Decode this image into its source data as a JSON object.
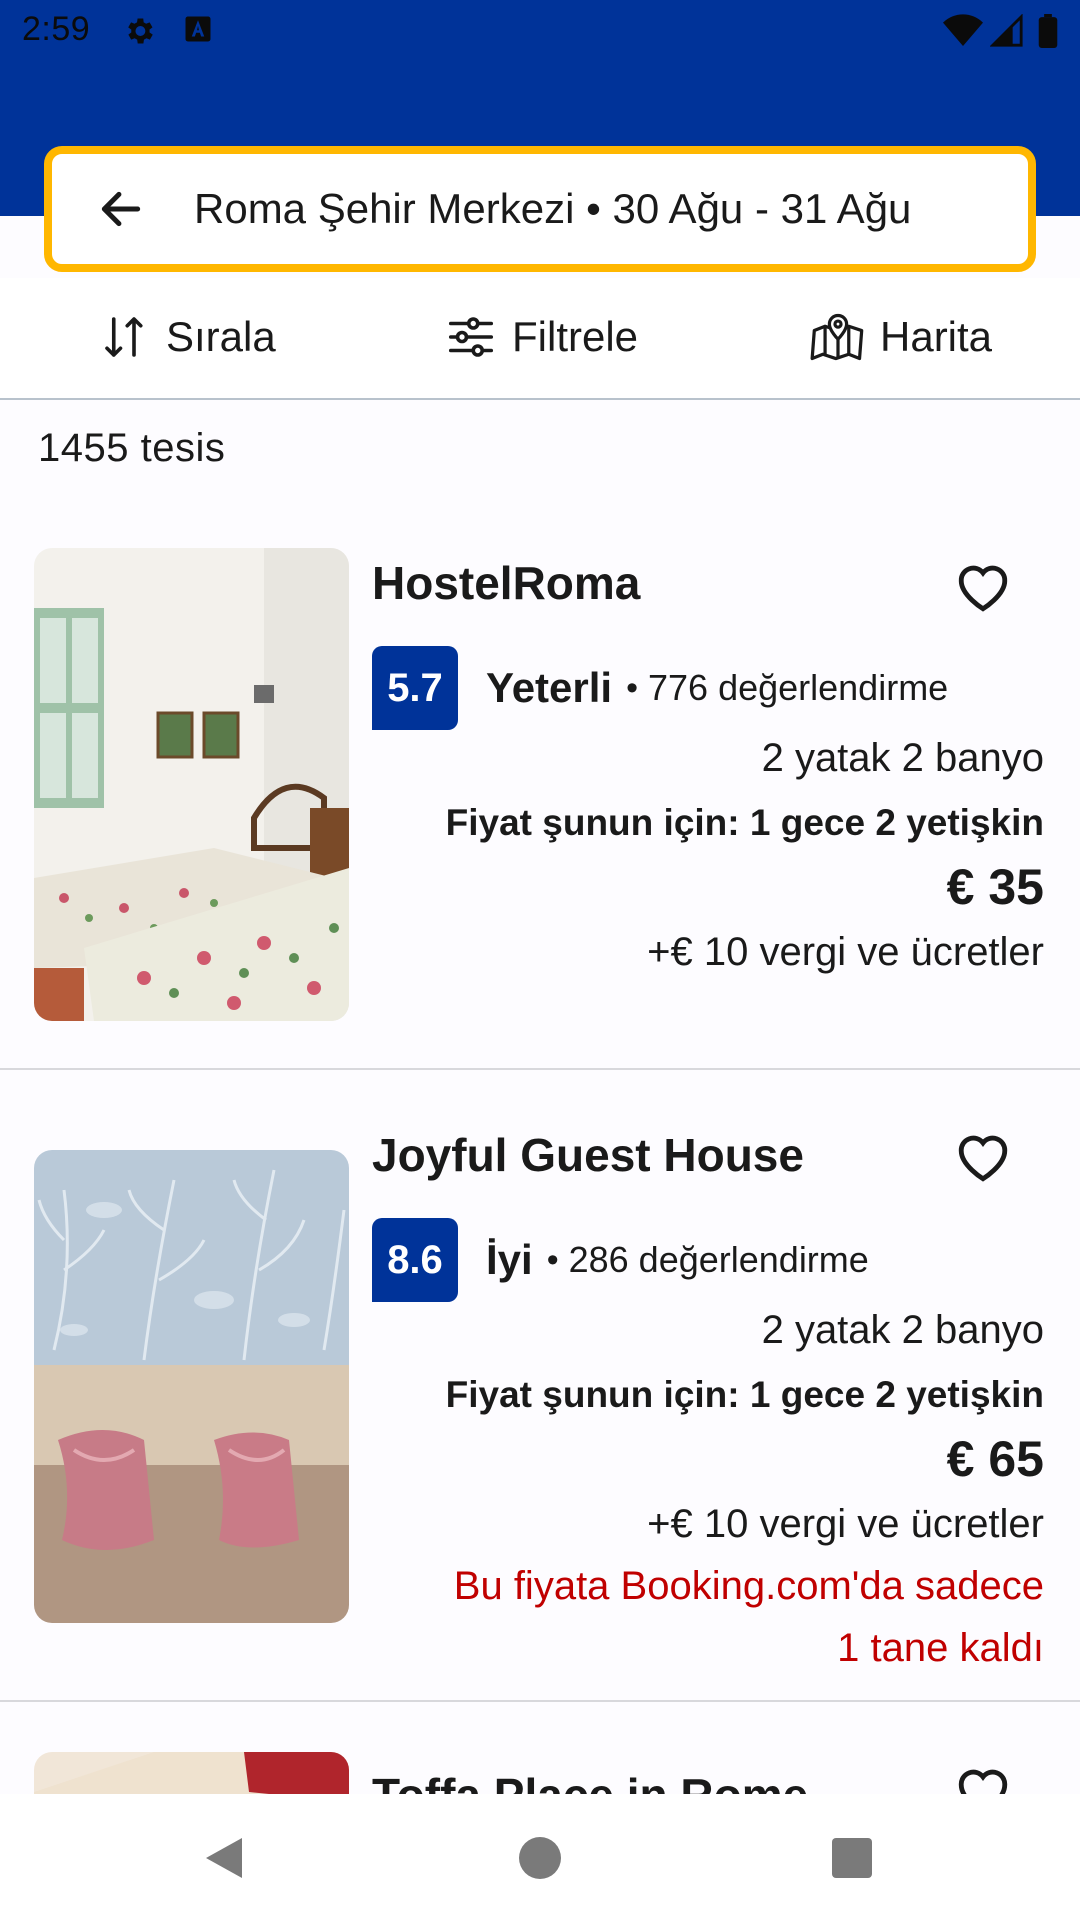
{
  "status_bar": {
    "time": "2:59",
    "icons": [
      "gear-icon",
      "a-icon",
      "wifi-icon",
      "signal-icon",
      "battery-icon"
    ]
  },
  "search": {
    "summary": "Roma Şehir Merkezi • 30 Ağu - 31 Ağu"
  },
  "toolbar": {
    "sort_label": "Sırala",
    "filter_label": "Filtrele",
    "map_label": "Harita"
  },
  "results": {
    "count_label": "1455 tesis",
    "items": [
      {
        "name": "HostelRoma",
        "score": "5.7",
        "rating_word": "Yeterli",
        "reviews": "776 değerlendirme",
        "beds": "2 yatak 2 banyo",
        "price_for": "Fiyat şunun için: 1 gece 2 yetişkin",
        "price": "€ 35",
        "taxes": "+€ 10 vergi ve ücretler"
      },
      {
        "name": "Joyful Guest House",
        "score": "8.6",
        "rating_word": "İyi",
        "reviews": "286 değerlendirme",
        "beds": "2 yatak 2 banyo",
        "price_for": "Fiyat şunun için: 1 gece 2 yetişkin",
        "price": "€ 65",
        "taxes": "+€ 10 vergi ve ücretler",
        "scarcity_line1": "Bu fiyata Booking.com'da sadece",
        "scarcity_line2": "1 tane kaldı"
      },
      {
        "name": "Toffa Place in Rome"
      }
    ]
  },
  "colors": {
    "brand_blue": "#003399",
    "search_border": "#ffb700",
    "scarcity_red": "#c00000"
  }
}
